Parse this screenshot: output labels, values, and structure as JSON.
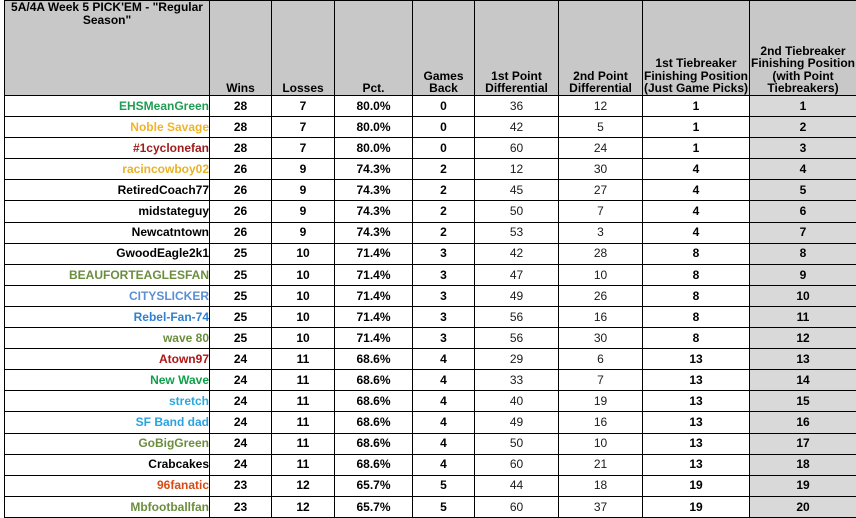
{
  "title": "5A/4A Week 5 PICK'EM - \"Regular Season\"",
  "columns": {
    "wins": "Wins",
    "losses": "Losses",
    "pct": "Pct.",
    "games_back": "Games Back",
    "point_diff_1": "1st Point Differential",
    "point_diff_2": "2nd Point Differential",
    "tiebreaker_1": "1st Tiebreaker Finishing Position (Just Game Picks)",
    "tiebreaker_2": "2nd Tiebreaker Finishing Position (with Point Tiebreakers)"
  },
  "colors": {
    "header_bg": "#c8c8c8",
    "shaded_col_bg": "#d9d9d9",
    "grid": "#000000"
  },
  "rows": [
    {
      "name": "EHSMeanGreen",
      "color": "#1f9e52",
      "wins": 28,
      "losses": 7,
      "pct": "80.0%",
      "games_back": 0,
      "pd1": 36,
      "pd2": 12,
      "tb1": 1,
      "tb2": 1
    },
    {
      "name": "Noble Savage",
      "color": "#f0b429",
      "wins": 28,
      "losses": 7,
      "pct": "80.0%",
      "games_back": 0,
      "pd1": 42,
      "pd2": 5,
      "tb1": 1,
      "tb2": 2
    },
    {
      "name": "#1cyclonefan",
      "color": "#9e1b1b",
      "wins": 28,
      "losses": 7,
      "pct": "80.0%",
      "games_back": 0,
      "pd1": 60,
      "pd2": 24,
      "tb1": 1,
      "tb2": 3
    },
    {
      "name": "racincowboy02",
      "color": "#e8b229",
      "wins": 26,
      "losses": 9,
      "pct": "74.3%",
      "games_back": 2,
      "pd1": 12,
      "pd2": 30,
      "tb1": 4,
      "tb2": 4
    },
    {
      "name": "RetiredCoach77",
      "color": "#000000",
      "wins": 26,
      "losses": 9,
      "pct": "74.3%",
      "games_back": 2,
      "pd1": 45,
      "pd2": 27,
      "tb1": 4,
      "tb2": 5
    },
    {
      "name": "midstateguy",
      "color": "#000000",
      "wins": 26,
      "losses": 9,
      "pct": "74.3%",
      "games_back": 2,
      "pd1": 50,
      "pd2": 7,
      "tb1": 4,
      "tb2": 6
    },
    {
      "name": "Newcatntown",
      "color": "#000000",
      "wins": 26,
      "losses": 9,
      "pct": "74.3%",
      "games_back": 2,
      "pd1": 53,
      "pd2": 3,
      "tb1": 4,
      "tb2": 7
    },
    {
      "name": "GwoodEagle2k1",
      "color": "#000000",
      "wins": 25,
      "losses": 10,
      "pct": "71.4%",
      "games_back": 3,
      "pd1": 42,
      "pd2": 28,
      "tb1": 8,
      "tb2": 8
    },
    {
      "name": "BEAUFORTEAGLESFAN",
      "color": "#6b8e3e",
      "wins": 25,
      "losses": 10,
      "pct": "71.4%",
      "games_back": 3,
      "pd1": 47,
      "pd2": 10,
      "tb1": 8,
      "tb2": 9
    },
    {
      "name": "CITYSLICKER",
      "color": "#5b8fd4",
      "wins": 25,
      "losses": 10,
      "pct": "71.4%",
      "games_back": 3,
      "pd1": 49,
      "pd2": 26,
      "tb1": 8,
      "tb2": 10
    },
    {
      "name": "Rebel-Fan-74",
      "color": "#2f7fd0",
      "wins": 25,
      "losses": 10,
      "pct": "71.4%",
      "games_back": 3,
      "pd1": 56,
      "pd2": 16,
      "tb1": 8,
      "tb2": 11
    },
    {
      "name": "wave 80",
      "color": "#6b8e3e",
      "wins": 25,
      "losses": 10,
      "pct": "71.4%",
      "games_back": 3,
      "pd1": 56,
      "pd2": 30,
      "tb1": 8,
      "tb2": 12
    },
    {
      "name": "Atown97",
      "color": "#b01515",
      "wins": 24,
      "losses": 11,
      "pct": "68.6%",
      "games_back": 4,
      "pd1": 29,
      "pd2": 6,
      "tb1": 13,
      "tb2": 13
    },
    {
      "name": "New Wave",
      "color": "#10a04a",
      "wins": 24,
      "losses": 11,
      "pct": "68.6%",
      "games_back": 4,
      "pd1": 33,
      "pd2": 7,
      "tb1": 13,
      "tb2": 14
    },
    {
      "name": "stretch",
      "color": "#2aa8e0",
      "wins": 24,
      "losses": 11,
      "pct": "68.6%",
      "games_back": 4,
      "pd1": 40,
      "pd2": 19,
      "tb1": 13,
      "tb2": 15
    },
    {
      "name": "SF Band dad",
      "color": "#29a3e0",
      "wins": 24,
      "losses": 11,
      "pct": "68.6%",
      "games_back": 4,
      "pd1": 49,
      "pd2": 16,
      "tb1": 13,
      "tb2": 16
    },
    {
      "name": "GoBigGreen",
      "color": "#6b8e3e",
      "wins": 24,
      "losses": 11,
      "pct": "68.6%",
      "games_back": 4,
      "pd1": 50,
      "pd2": 10,
      "tb1": 13,
      "tb2": 17
    },
    {
      "name": "Crabcakes",
      "color": "#000000",
      "wins": 24,
      "losses": 11,
      "pct": "68.6%",
      "games_back": 4,
      "pd1": 60,
      "pd2": 21,
      "tb1": 13,
      "tb2": 18
    },
    {
      "name": "96fanatic",
      "color": "#d84a16",
      "wins": 23,
      "losses": 12,
      "pct": "65.7%",
      "games_back": 5,
      "pd1": 44,
      "pd2": 18,
      "tb1": 19,
      "tb2": 19
    },
    {
      "name": "Mbfootballfan",
      "color": "#6b8e3e",
      "wins": 23,
      "losses": 12,
      "pct": "65.7%",
      "games_back": 5,
      "pd1": 60,
      "pd2": 37,
      "tb1": 19,
      "tb2": 20
    }
  ]
}
